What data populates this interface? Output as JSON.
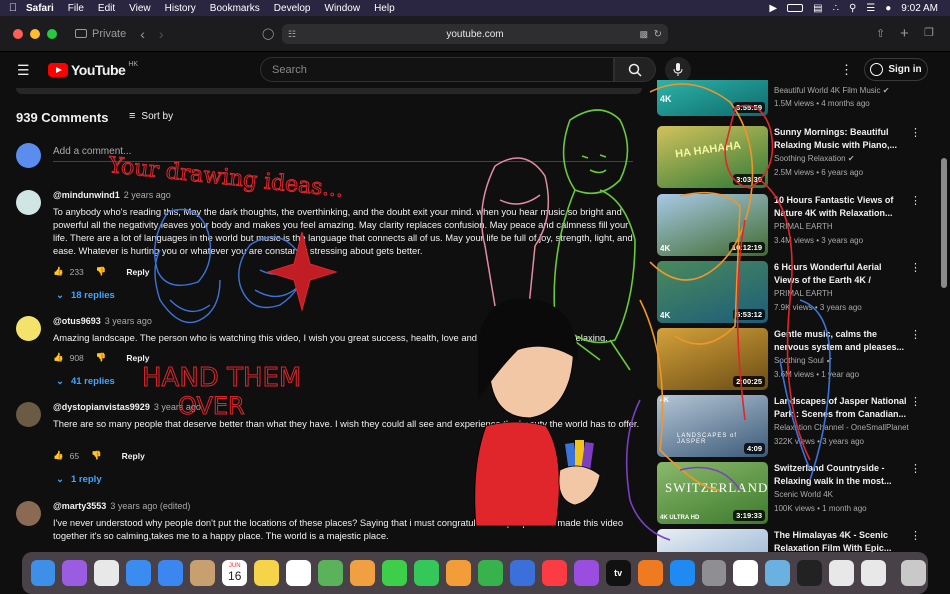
{
  "menubar": {
    "app": "Safari",
    "items": [
      "File",
      "Edit",
      "View",
      "History",
      "Bookmarks",
      "Develop",
      "Window",
      "Help"
    ],
    "time": "9:02 AM"
  },
  "toolbar": {
    "private_label": "Private",
    "url": "youtube.com"
  },
  "youtube": {
    "region": "HK",
    "search_placeholder": "Search",
    "signin_label": "Sign in",
    "logo_text": "YouTube"
  },
  "comments": {
    "count_label": "939 Comments",
    "sort_label": "Sort by",
    "add_placeholder": "Add a comment...",
    "items": [
      {
        "author": "@mindunwind1",
        "time": "2 years ago",
        "text": "To anybody who's reading this, May the dark thoughts, the overthinking, and the doubt exit your mind. when you hear music so bright and powerful all the negativity leaves your body and makes you feel amazing. May clarity replaces confusion. May peace and calmness fill your life. There are a lot of languages in the world but music is the language that connects all of us. May your life be full of joy, strength, light, and ease. Whatever is hurting you or whatever you are constantly stressing about gets better.",
        "likes": "233",
        "reply_label": "Reply",
        "replies_label": "18 replies"
      },
      {
        "author": "@otus9693",
        "time": "3 years ago",
        "text": "Amazing landscape. The person who is watching this video, I wish you great success, health, love and happiness. Sleep and relaxing.",
        "likes": "908",
        "reply_label": "Reply",
        "replies_label": "41 replies"
      },
      {
        "author": "@dystopianvistas9929",
        "time": "3 years ago",
        "text": "There are so many people that deserve better than what they have. I wish they could all see and experience the beauty the world has to offer.",
        "likes": "65",
        "reply_label": "Reply",
        "replies_label": "1 reply"
      },
      {
        "author": "@marty3553",
        "time": "3 years ago (edited)",
        "text": "I've never understood why people don't put the locations of these places? Saying that i must congratulate the people who made this video together it's so calming,takes me to a happy place. The world is a majestic place."
      }
    ]
  },
  "sidebar": {
    "videos": [
      {
        "title": "",
        "channel": "Beautiful World 4K Film Music",
        "verified": true,
        "meta": "1.5M views • 4 months ago",
        "duration": "3:55:59",
        "badge": "4K",
        "colors": [
          "#0c6b6d",
          "#2fb2a8"
        ]
      },
      {
        "title": "Sunny Mornings: Beautiful Relaxing Music with Piano,...",
        "channel": "Soothing Relaxation",
        "verified": true,
        "meta": "2.5M views • 6 years ago",
        "duration": "3:03:39",
        "badge": "",
        "overlay_text": "HA HAHAHA",
        "colors": [
          "#2f7a37",
          "#d1c25c"
        ]
      },
      {
        "title": "10 Hours Fantastic Views of Nature 4K with Relaxation...",
        "channel": "PRIMAL EARTH",
        "verified": false,
        "meta": "3.4M views • 3 years ago",
        "duration": "10:12:19",
        "badge": "4K",
        "colors": [
          "#3f6b2f",
          "#a8c9e6"
        ]
      },
      {
        "title": "6 Hours Wonderful Aerial Views of the Earth 4K / Relaxation...",
        "channel": "PRIMAL EARTH",
        "verified": false,
        "meta": "7.9K views • 3 years ago",
        "duration": "5:53:12",
        "badge": "4K",
        "colors": [
          "#1c5d7a",
          "#4a8a5c"
        ]
      },
      {
        "title": "Gentle music, calms the nervous system and pleases...",
        "channel": "Soothing Soul",
        "verified": true,
        "meta": "3.6M views • 1 year ago",
        "duration": "2:00:25",
        "badge": "",
        "colors": [
          "#6a4c14",
          "#d5a23a"
        ]
      },
      {
        "title": "Landscapes of Jasper National Park : Scenes from Canadian...",
        "channel": "Relaxation Channel - OneSmallPlanet",
        "verified": false,
        "meta": "322K views • 3 years ago",
        "duration": "4:09",
        "badge": "4K",
        "overlay_text": "LANDSCAPES of JASPER",
        "colors": [
          "#3b5a78",
          "#b5c6d6"
        ]
      },
      {
        "title": "Switzerland Countryside - Relaxing walk in the most...",
        "channel": "Scenic World 4K",
        "verified": false,
        "meta": "100K views • 1 month ago",
        "duration": "3:19:33",
        "badge": "4K ULTRA HD",
        "overlay_text": "SWITZERLAND",
        "colors": [
          "#3d7a2c",
          "#8ab96c"
        ]
      },
      {
        "title": "The Himalayas 4K - Scenic Relaxation Film With Epic...",
        "channel": "",
        "verified": false,
        "meta": "",
        "duration": "",
        "badge": "",
        "colors": [
          "#7fa4c8",
          "#e8eef5"
        ]
      }
    ]
  },
  "drawing": {
    "texts": [
      "Your drawing ideas...",
      "HAND THEM",
      "OVER"
    ],
    "colors": {
      "red": "#e0262b",
      "blue": "#3b74d9",
      "green": "#6ac83a",
      "orange": "#f0962a",
      "purple": "#7b3fc0",
      "pink": "#e08da0"
    }
  },
  "dock": {
    "icons": [
      "finder-icon",
      "siri-icon",
      "launchpad-icon",
      "safari-icon",
      "mail-icon",
      "contacts-icon",
      "calendar-icon",
      "notes-icon",
      "reminders-icon",
      "maps-icon",
      "photos-icon",
      "messages-icon",
      "facetime-icon",
      "pages-icon",
      "numbers-icon",
      "keynote-icon",
      "music-icon",
      "podcasts-icon",
      "tv-icon",
      "books-icon",
      "appstore-icon",
      "settings-icon",
      "chrome-icon",
      "preview-icon",
      "terminal-icon",
      "screenshot-icon",
      "downloads-icon",
      "trash-icon"
    ],
    "calendar_month": "JUN",
    "calendar_day": "16",
    "tv_label": "tv"
  }
}
